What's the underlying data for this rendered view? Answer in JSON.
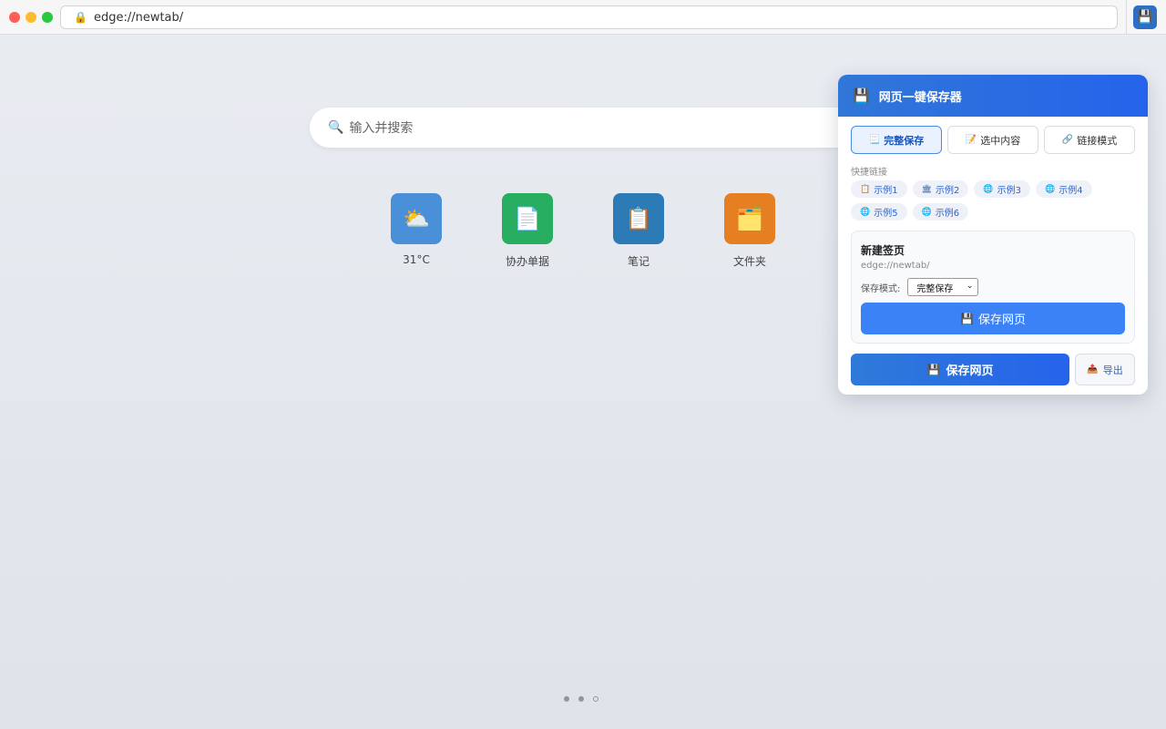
{
  "browser": {
    "url": "edge://newtab/",
    "lock_icon": "🔒",
    "extension_icon": "💾"
  },
  "search": {
    "icon": "🔍",
    "placeholder": "输入并搜索"
  },
  "tiles": [
    {
      "icon": "⛅",
      "label": "31°C",
      "color": "#4a90d9"
    },
    {
      "icon": "📄",
      "label": "协办单据",
      "color": "#27ae60"
    },
    {
      "icon": "📋",
      "label": "笔记",
      "color": "#2c7bb6"
    },
    {
      "icon": "🗂️",
      "label": "文件夹",
      "color": "#e67e22"
    }
  ],
  "popup": {
    "header_icon": "💾",
    "title": "网页一键保存器",
    "tabs": [
      {
        "icon": "📃",
        "label": "完整保存",
        "active": true
      },
      {
        "icon": "📝",
        "label": "选中内容",
        "active": false
      },
      {
        "icon": "🔗",
        "label": "链接模式",
        "active": false
      }
    ],
    "quick_links_title": "快捷链接",
    "quick_links": [
      {
        "icon": "📋",
        "label": "示例1"
      },
      {
        "icon": "🏛",
        "label": "示例2"
      },
      {
        "icon": "🌐",
        "label": "示例3"
      },
      {
        "icon": "🌐",
        "label": "示例4"
      },
      {
        "icon": "🌐",
        "label": "示例5"
      },
      {
        "icon": "🌐",
        "label": "示例6"
      }
    ],
    "page_card": {
      "title": "新建签页",
      "url": "edge://newtab/",
      "mode_label": "保存模式:",
      "mode_value": "完整保存",
      "save_icon": "💾",
      "save_label": "保存网页"
    },
    "main_save": {
      "icon": "💾",
      "label": "保存网页"
    },
    "export": {
      "icon": "📤",
      "label": "导出"
    }
  },
  "pagination": {
    "total": 3,
    "current": 3
  }
}
